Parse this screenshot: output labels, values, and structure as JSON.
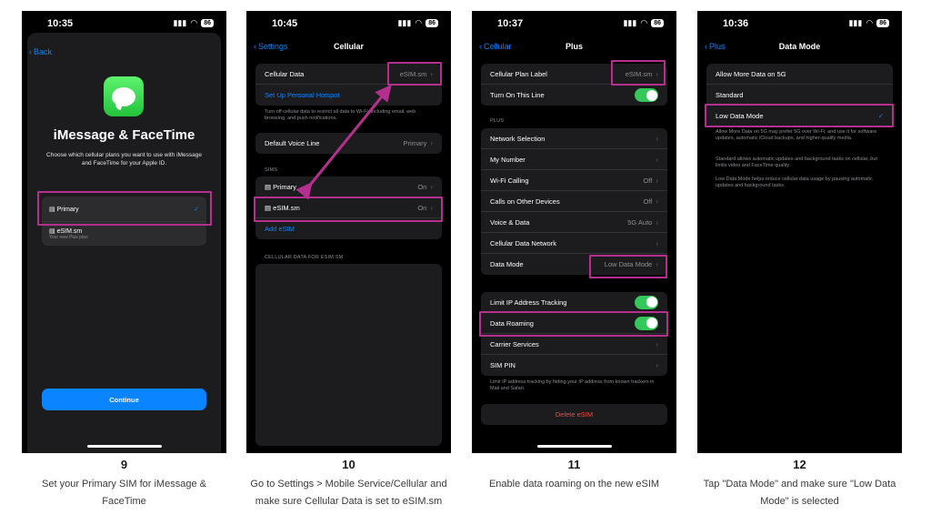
{
  "status": {
    "battery": "86"
  },
  "panels": [
    {
      "time": "10:35",
      "back": "Back",
      "title": "iMessage & FaceTime",
      "subtitle": "Choose which cellular plans you want to use with iMessage and FaceTime for your Apple ID.",
      "sims": [
        {
          "label": "Primary",
          "checked": true
        },
        {
          "label": "eSIM.sm",
          "sub": "Your new Plus plan"
        }
      ],
      "continue": "Continue",
      "step": "9",
      "caption": "Set your Primary SIM for iMessage & FaceTime"
    },
    {
      "time": "10:45",
      "back": "Settings",
      "title": "Cellular",
      "cellular_data_label": "Cellular Data",
      "cellular_data_value": "eSIM.sm",
      "hotspot": "Set Up Personal Hotspot",
      "note": "Turn off cellular data to restrict all data to Wi-Fi, including email, web browsing, and push notifications.",
      "voice_label": "Default Voice Line",
      "voice_value": "Primary",
      "sims_header": "SIMs",
      "sim1_label": "Primary",
      "sim1_value": "On",
      "sim2_label": "eSIM.sm",
      "sim2_value": "On",
      "add_esim": "Add eSIM",
      "data_header": "CELLULAR DATA FOR ESIM.SM",
      "step": "10",
      "caption": "Go to Settings > Mobile Service/Cellular and make sure Cellular Data is set to eSIM.sm"
    },
    {
      "time": "10:37",
      "back": "Cellular",
      "title": "Plus",
      "plan_label": "Cellular Plan Label",
      "plan_value": "eSIM.sm",
      "turn_on": "Turn On This Line",
      "section": "PLUS",
      "rows": [
        {
          "label": "Network Selection",
          "value": ""
        },
        {
          "label": "My Number",
          "value": ""
        },
        {
          "label": "Wi-Fi Calling",
          "value": "Off"
        },
        {
          "label": "Calls on Other Devices",
          "value": "Off"
        },
        {
          "label": "Voice & Data",
          "value": "5G Auto"
        },
        {
          "label": "Cellular Data Network",
          "value": ""
        },
        {
          "label": "Data Mode",
          "value": "Low Data Mode"
        }
      ],
      "limit_ip": "Limit IP Address Tracking",
      "roaming": "Data Roaming",
      "carrier": "Carrier Services",
      "sim_pin": "SIM PIN",
      "note": "Limit IP address tracking by hiding your IP address from known trackers in Mail and Safari.",
      "delete": "Delete eSIM",
      "step": "11",
      "caption": "Enable data roaming on the new eSIM"
    },
    {
      "time": "10:36",
      "back": "Plus",
      "title": "Data Mode",
      "options": [
        "Allow More Data on 5G",
        "Standard",
        "Low Data Mode"
      ],
      "note1": "Allow More Data on 5G may prefer 5G over Wi-Fi, and use it for software updates, automatic iCloud backups, and higher-quality media.",
      "note2": "Standard allows automatic updates and background tasks on cellular, but limits video and FaceTime quality.",
      "note3": "Low Data Mode helps reduce cellular data usage by pausing automatic updates and background tasks.",
      "step": "12",
      "caption": "Tap \"Data Mode\" and make sure \"Low Data Mode\" is selected"
    }
  ]
}
